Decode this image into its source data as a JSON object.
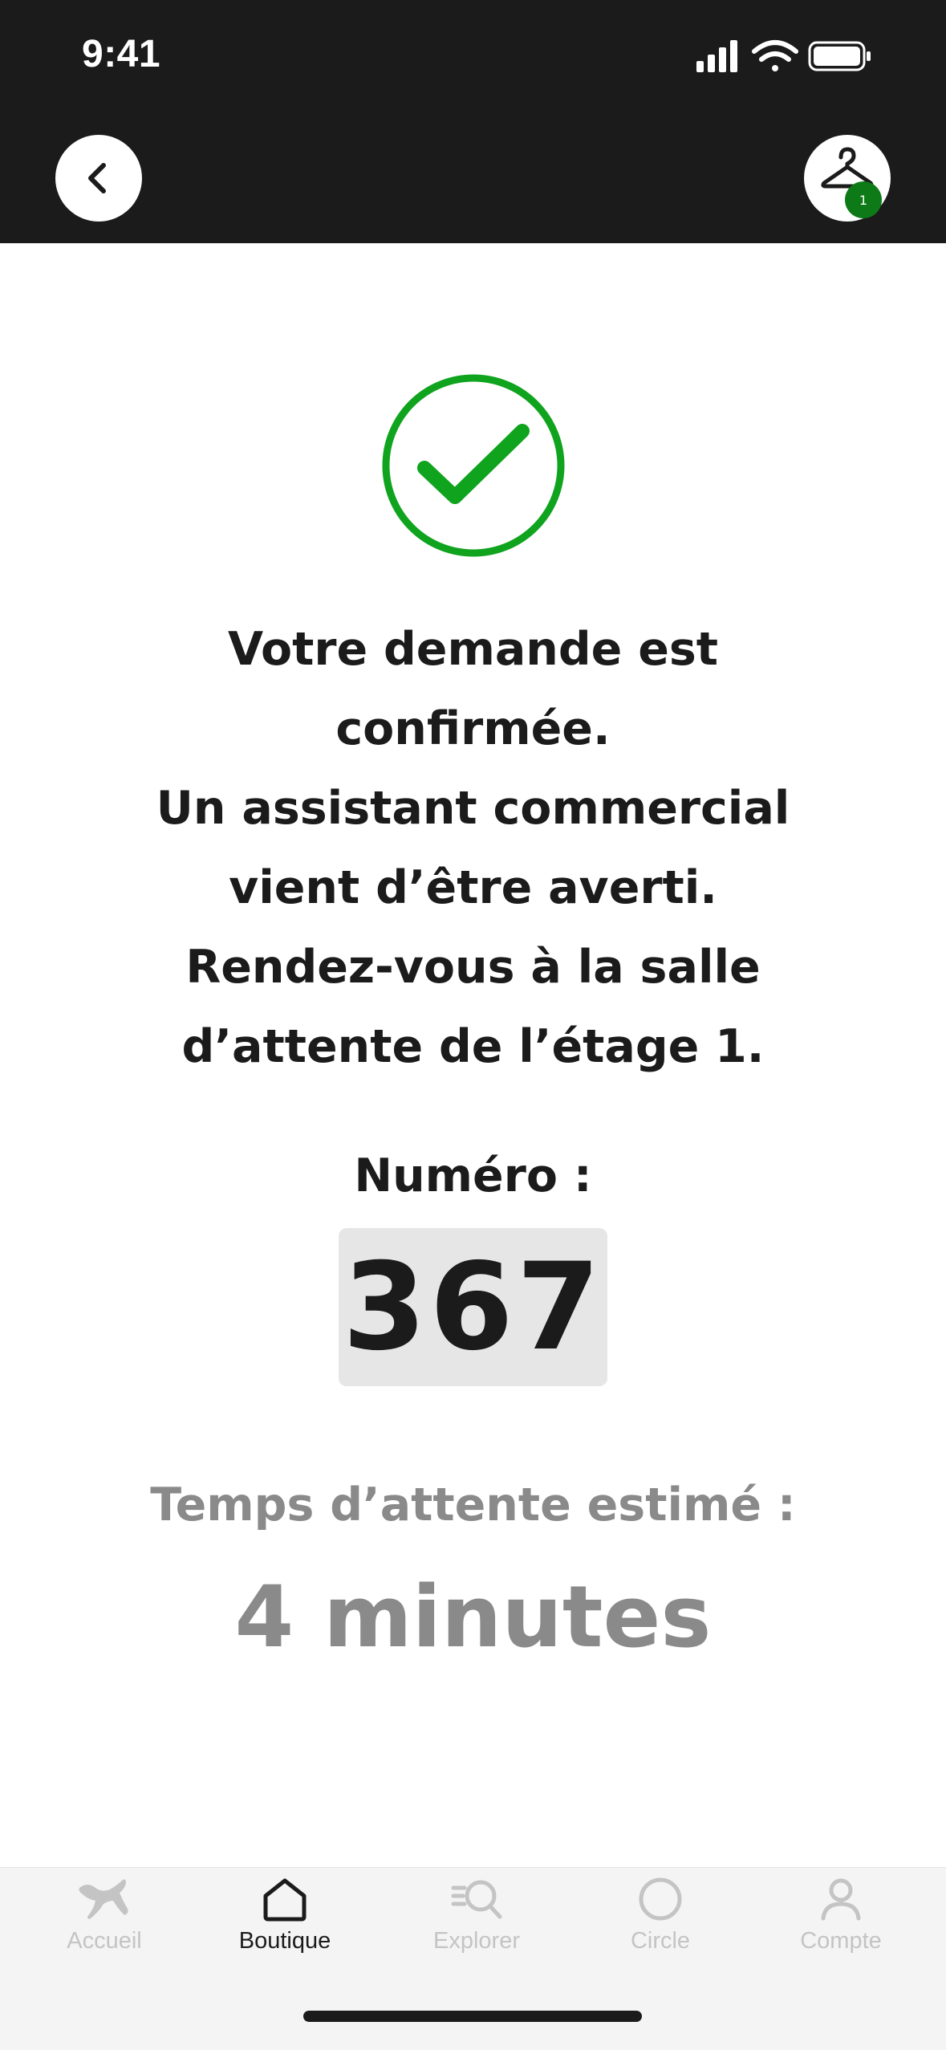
{
  "status_bar": {
    "time": "9:41"
  },
  "header": {
    "cart_count": "1"
  },
  "confirmation": {
    "lines": [
      "Votre demande est",
      "confirmée.",
      "Un assistant commercial",
      "vient d’être averti.",
      "Rendez-vous à la salle",
      "d’attente de l’étage 1."
    ],
    "number_label": "Numéro :",
    "number": "367",
    "wait_label": "Temps d’attente estimé :",
    "wait_value": "4 minutes"
  },
  "tabbar": {
    "tabs": [
      {
        "label": "Accueil",
        "icon": "puma-icon"
      },
      {
        "label": "Boutique",
        "icon": "home-icon",
        "active": true
      },
      {
        "label": "Explorer",
        "icon": "search-icon"
      },
      {
        "label": "Circle",
        "icon": "circle-icon"
      },
      {
        "label": "Compte",
        "icon": "person-icon"
      }
    ]
  },
  "colors": {
    "header_bg": "#1b1b1b",
    "success_green": "#0fa31e",
    "badge_green": "#0d7a17",
    "muted_text": "#8a8a8a",
    "number_box_bg": "#e6e6e6"
  }
}
